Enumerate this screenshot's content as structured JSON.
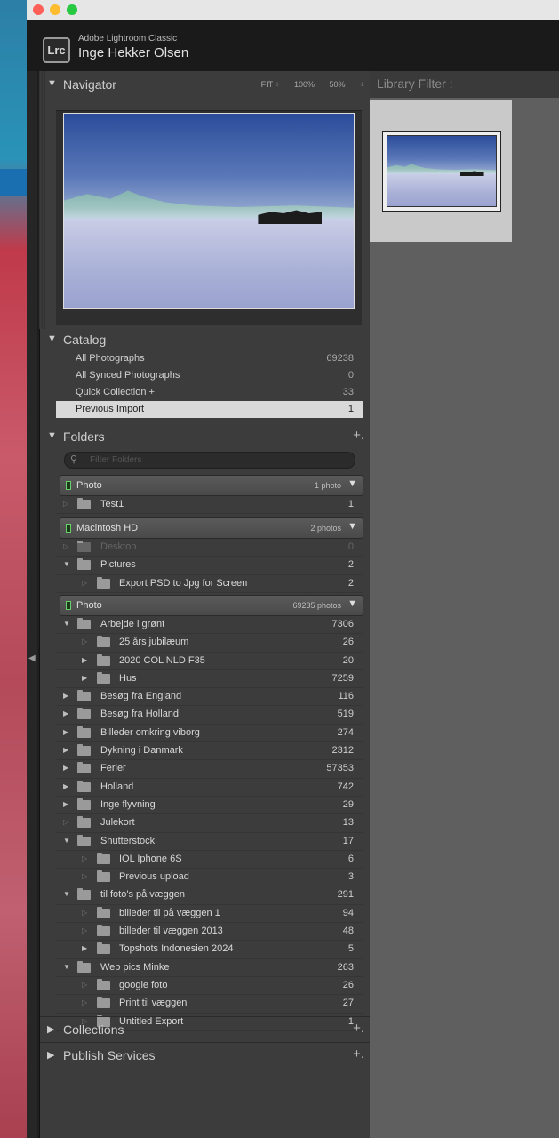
{
  "window": {
    "app_name": "Adobe Lightroom Classic",
    "logo": "Lrc",
    "user": "Inge Hekker Olsen"
  },
  "navigator": {
    "title": "Navigator",
    "options": [
      "FIT ÷",
      "100%",
      "50%",
      "÷"
    ]
  },
  "catalog": {
    "title": "Catalog",
    "items": [
      {
        "label": "All Photographs",
        "count": "69238"
      },
      {
        "label": "All Synced Photographs",
        "count": "0"
      },
      {
        "label": "Quick Collection +",
        "count": "33"
      },
      {
        "label": "Previous Import",
        "count": "1"
      }
    ]
  },
  "folders": {
    "title": "Folders",
    "plus": "+.",
    "filter_placeholder": "Filter Folders",
    "volumes": [
      {
        "name": "Photo",
        "count": "1 photo",
        "items": [
          {
            "name": "Test1",
            "count": "1"
          }
        ]
      },
      {
        "name": "Macintosh HD",
        "count": "2 photos",
        "items": [
          {
            "name": "Desktop",
            "count": "0"
          },
          {
            "name": "Pictures",
            "count": "2"
          },
          {
            "name": "Export PSD to Jpg for Screen",
            "count": "2"
          }
        ]
      },
      {
        "name": "Photo",
        "count": "69235 photos",
        "items": [
          {
            "name": "Arbejde i grønt",
            "count": "7306"
          },
          {
            "name": "25 års jubilæum",
            "count": "26"
          },
          {
            "name": "2020 COL NLD F35",
            "count": "20"
          },
          {
            "name": "Hus",
            "count": "7259"
          },
          {
            "name": "Besøg fra England",
            "count": "116"
          },
          {
            "name": "Besøg fra Holland",
            "count": "519"
          },
          {
            "name": "Billeder omkring viborg",
            "count": "274"
          },
          {
            "name": "Dykning i Danmark",
            "count": "2312"
          },
          {
            "name": "Ferier",
            "count": "57353"
          },
          {
            "name": "Holland",
            "count": "742"
          },
          {
            "name": "Inge flyvning",
            "count": "29"
          },
          {
            "name": "Julekort",
            "count": "13"
          },
          {
            "name": "Shutterstock",
            "count": "17"
          },
          {
            "name": "IOL Iphone 6S",
            "count": "6"
          },
          {
            "name": "Previous upload",
            "count": "3"
          },
          {
            "name": "til foto's på væggen",
            "count": "291"
          },
          {
            "name": "billeder til på væggen 1",
            "count": "94"
          },
          {
            "name": "billeder til væggen 2013",
            "count": "48"
          },
          {
            "name": "Topshots Indonesien 2024",
            "count": "5"
          },
          {
            "name": "Web pics Minke",
            "count": "263"
          },
          {
            "name": "google foto",
            "count": "26"
          },
          {
            "name": "Print til væggen",
            "count": "27"
          },
          {
            "name": "Untitled Export",
            "count": "1"
          }
        ]
      }
    ]
  },
  "collections": {
    "title": "Collections",
    "plus": "+."
  },
  "publish": {
    "title": "Publish Services",
    "plus": "+."
  },
  "library_filter": {
    "title": "Library Filter :"
  },
  "icons": {
    "expanded": "triangle-down-icon",
    "collapsed": "triangle-right-icon",
    "folder": "folder-icon"
  }
}
